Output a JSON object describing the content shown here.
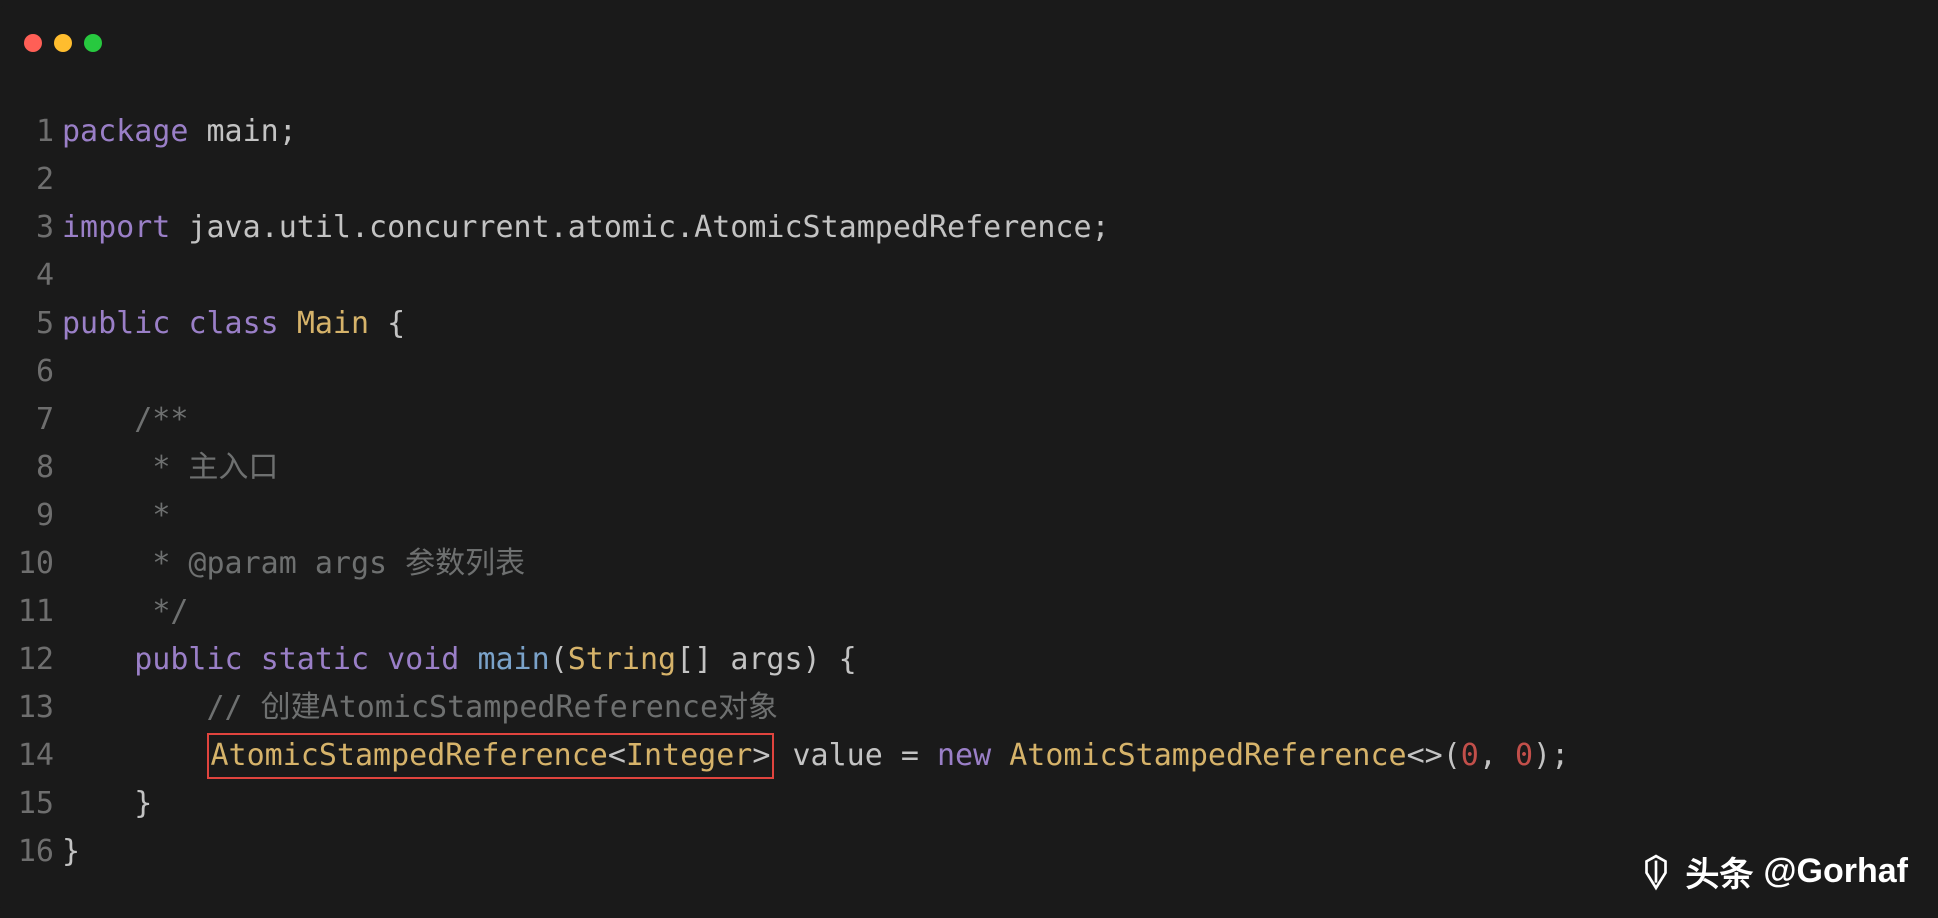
{
  "traffic_lights": [
    "close",
    "minimize",
    "zoom"
  ],
  "gutter": [
    "1",
    "2",
    "3",
    "4",
    "5",
    "6",
    "7",
    "8",
    "9",
    "10",
    "11",
    "12",
    "13",
    "14",
    "15",
    "16"
  ],
  "code": {
    "l1": {
      "kw_package": "package",
      "pkg": " main",
      "semi": ";"
    },
    "l3": {
      "kw_import": "import",
      "path": " java.util.concurrent.atomic.AtomicStampedReference",
      "semi": ";"
    },
    "l5": {
      "kw_public": "public",
      "sp1": " ",
      "kw_class": "class",
      "sp2": " ",
      "classname": "Main",
      "brace": " {"
    },
    "l7": {
      "indent": "    ",
      "c": "/**"
    },
    "l8": {
      "indent": "     ",
      "c": "* 主入口"
    },
    "l9": {
      "indent": "     ",
      "c": "*"
    },
    "l10": {
      "indent": "     ",
      "c": "* @param args 参数列表"
    },
    "l11": {
      "indent": "     ",
      "c": "*/"
    },
    "l12": {
      "indent": "    ",
      "kw_public": "public",
      "sp1": " ",
      "kw_static": "static",
      "sp2": " ",
      "kw_void": "void",
      "sp3": " ",
      "method": "main",
      "lp": "(",
      "argtype": "String",
      "brackets": "[] ",
      "argname": "args",
      "rp": ")",
      "brace": " {"
    },
    "l13": {
      "indent": "        ",
      "c": "// 创建AtomicStampedReference对象"
    },
    "l14": {
      "indent": "        ",
      "box_type": "AtomicStampedReference",
      "box_lt": "<",
      "box_generic": "Integer",
      "box_gt": ">",
      "sp1": " ",
      "varname": "value",
      "eq": " = ",
      "kw_new": "new",
      "sp2": " ",
      "ctor": "AtomicStampedReference",
      "diamond": "<>",
      "lp": "(",
      "n1": "0",
      "comma": ", ",
      "n2": "0",
      "rp": ")",
      "semi": ";"
    },
    "l15": {
      "indent": "    ",
      "brace": "}"
    },
    "l16": {
      "brace": "}"
    }
  },
  "watermark": {
    "prefix": "头条",
    "handle": "@Gorhaf"
  }
}
